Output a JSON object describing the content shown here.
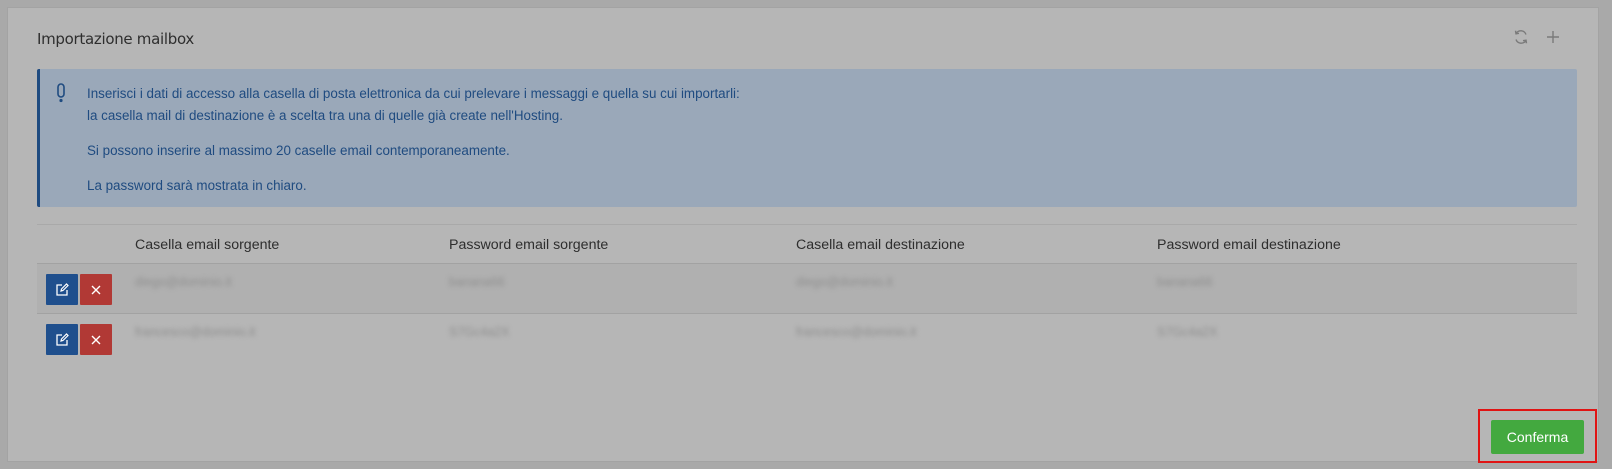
{
  "panel": {
    "title": "Importazione mailbox",
    "tools": [
      {
        "icon": "refresh-icon"
      },
      {
        "icon": "plus-icon"
      }
    ]
  },
  "alert": {
    "icon": "exclamation-icon",
    "line1": "Inserisci i dati di accesso alla casella di posta elettronica da cui prelevare i messaggi e quella su cui importarli:",
    "line2": "la casella mail di destinazione è a scelta tra una di quelle già create nell'Hosting.",
    "line3": "Si possono inserire al massimo 20 caselle email contemporaneamente.",
    "line4": "La password sarà mostrata in chiaro.",
    "colors": {
      "background": "#9aa8b9",
      "text": "#1f4b80"
    }
  },
  "table": {
    "headers": [
      "Casella email sorgente",
      "Password email sorgente",
      "Casella email destinazione",
      "Password email destinazione"
    ],
    "rows": [
      {
        "source_email": "diego@dominio.it",
        "source_password": "banana66",
        "dest_email": "diego@dominio.it",
        "dest_password": "banana66"
      },
      {
        "source_email": "francesco@dominio.it",
        "source_password": "S7Gc4a2X",
        "dest_email": "francesco@dominio.it",
        "dest_password": "S7Gc4a2X"
      }
    ],
    "row_actions": {
      "edit_icon": "edit-icon",
      "delete_icon": "close-icon"
    }
  },
  "footer": {
    "confirm_label": "Conferma",
    "confirm_color": "#43a93f"
  }
}
